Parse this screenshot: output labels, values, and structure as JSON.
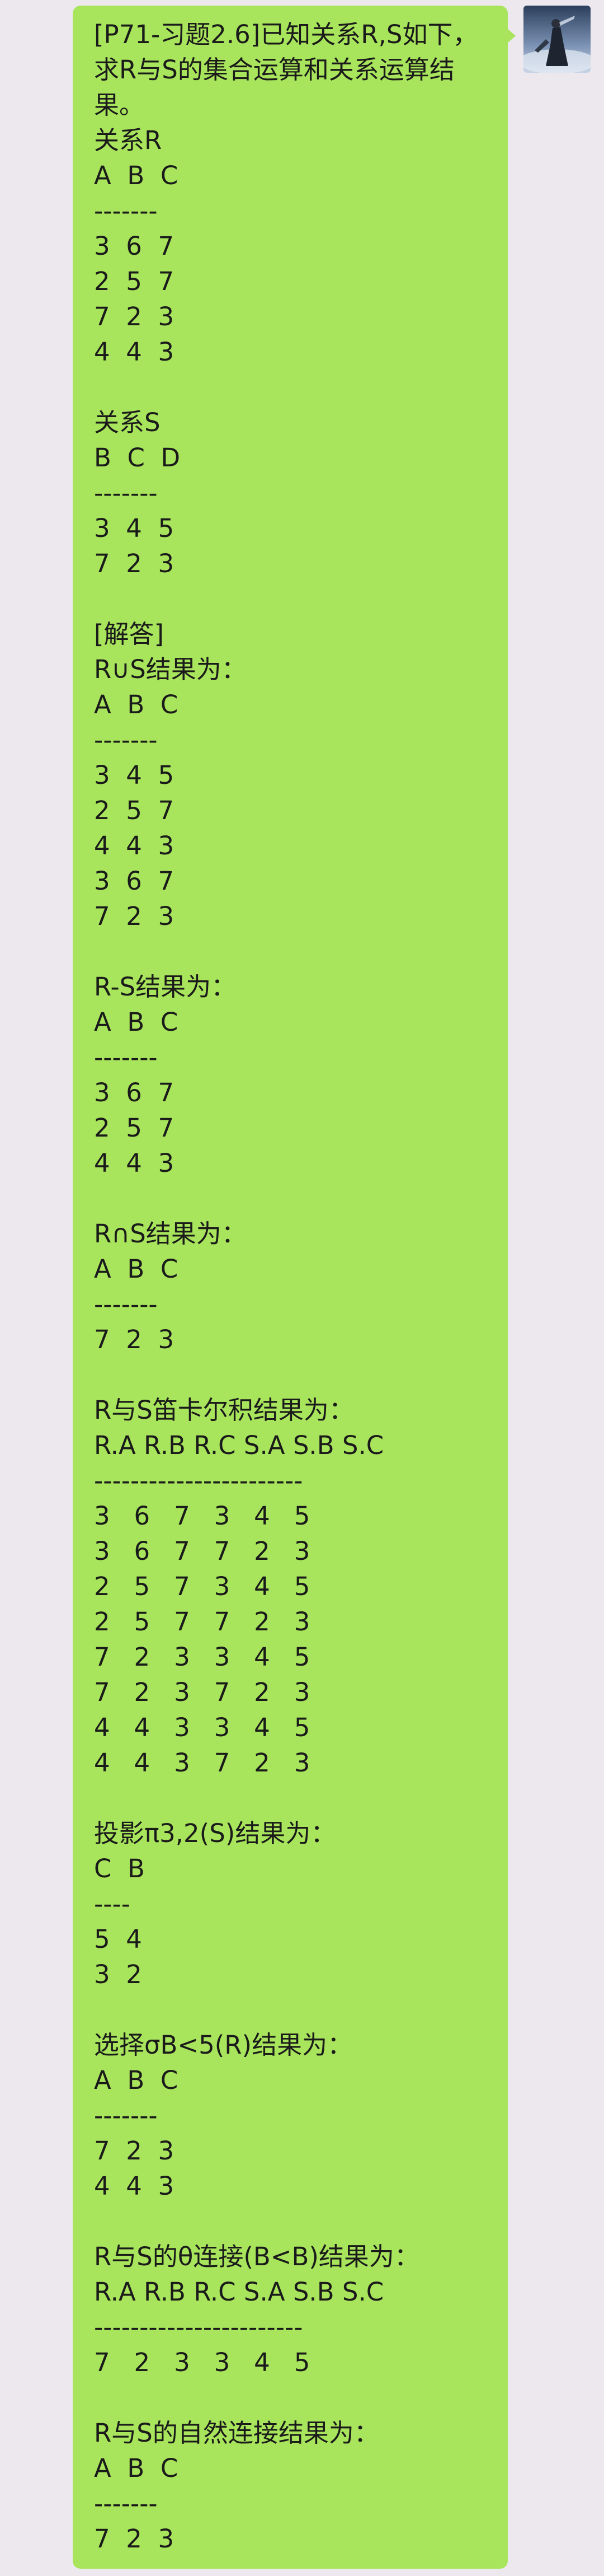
{
  "chat": {
    "sender_avatar": "avatar-icon",
    "message": {
      "text": "[P71-习题2.6]已知关系R,S如下，求R与S的集合运算和关系运算结果。\n关系R\nA  B  C\n-------\n3  6  7\n2  5  7\n7  2  3\n4  4  3\n\n关系S\nB  C  D\n-------\n3  4  5\n7  2  3\n\n[解答]\nR∪S结果为：\nA  B  C\n-------\n3  4  5\n2  5  7\n4  4  3\n3  6  7\n7  2  3\n\nR-S结果为：\nA  B  C\n-------\n3  6  7\n2  5  7\n4  4  3\n\nR∩S结果为：\nA  B  C\n-------\n7  2  3\n\nR与S笛卡尔积结果为：\nR.A R.B R.C S.A S.B S.C\n-----------------------\n3   6   7   3   4   5\n3   6   7   7   2   3\n2   5   7   3   4   5\n2   5   7   7   2   3\n7   2   3   3   4   5\n7   2   3   7   2   3\n4   4   3   3   4   5\n4   4   3   7   2   3\n\n投影π3,2(S)结果为：\nC  B\n----\n5  4\n3  2\n\n选择σB<5(R)结果为：\nA  B  C\n-------\n7  2  3\n4  4  3\n\nR与S的θ连接(B<B)结果为：\nR.A R.B R.C S.A S.B S.C\n-----------------------\n7   2   3   3   4   5\n\nR与S的自然连接结果为：\nA  B  C\n-------\n7  2  3"
    }
  },
  "colors": {
    "background": "#ede8ee",
    "bubble": "#a8e55c",
    "text": "#1a1a1a"
  }
}
